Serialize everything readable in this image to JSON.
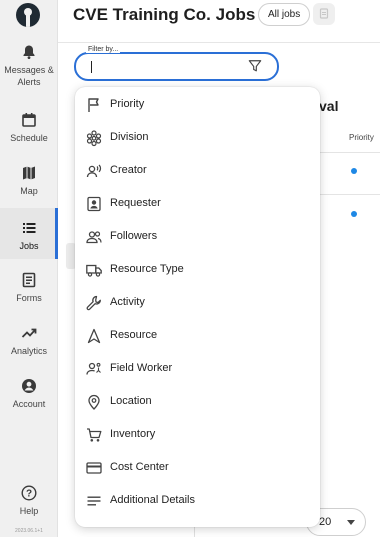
{
  "header": {
    "title": "CVE Training Co. Jobs",
    "all_jobs_label": "All jobs"
  },
  "sidebar": {
    "items": [
      {
        "label": "Messages & Alerts",
        "icon": "bell-icon"
      },
      {
        "label": "Schedule",
        "icon": "calendar-icon"
      },
      {
        "label": "Map",
        "icon": "map-icon"
      },
      {
        "label": "Jobs",
        "icon": "list-icon",
        "active": true
      },
      {
        "label": "Forms",
        "icon": "form-icon"
      },
      {
        "label": "Analytics",
        "icon": "trend-icon"
      },
      {
        "label": "Account",
        "icon": "account-icon"
      },
      {
        "label": "Help",
        "icon": "help-icon"
      }
    ],
    "version": "2023.06.1+1"
  },
  "filter": {
    "legend": "Filter by...",
    "value": ""
  },
  "background": {
    "section_heading": "val",
    "column_priority": "Priority",
    "page_size": "20"
  },
  "menu": {
    "items": [
      {
        "label": "Priority",
        "icon": "flag-icon"
      },
      {
        "label": "Division",
        "icon": "division-icon"
      },
      {
        "label": "Creator",
        "icon": "creator-icon"
      },
      {
        "label": "Requester",
        "icon": "requester-icon"
      },
      {
        "label": "Followers",
        "icon": "followers-icon"
      },
      {
        "label": "Resource Type",
        "icon": "truck-icon"
      },
      {
        "label": "Activity",
        "icon": "wrench-icon"
      },
      {
        "label": "Resource",
        "icon": "resource-icon"
      },
      {
        "label": "Field Worker",
        "icon": "field-worker-icon"
      },
      {
        "label": "Location",
        "icon": "location-pin-icon"
      },
      {
        "label": "Inventory",
        "icon": "cart-icon"
      },
      {
        "label": "Cost Center",
        "icon": "credit-card-icon"
      },
      {
        "label": "Additional Details",
        "icon": "details-icon"
      }
    ]
  },
  "colors": {
    "accent": "#2a6fd6",
    "dot": "#1e88e5",
    "sidebar_bg": "#f0f0f0"
  }
}
